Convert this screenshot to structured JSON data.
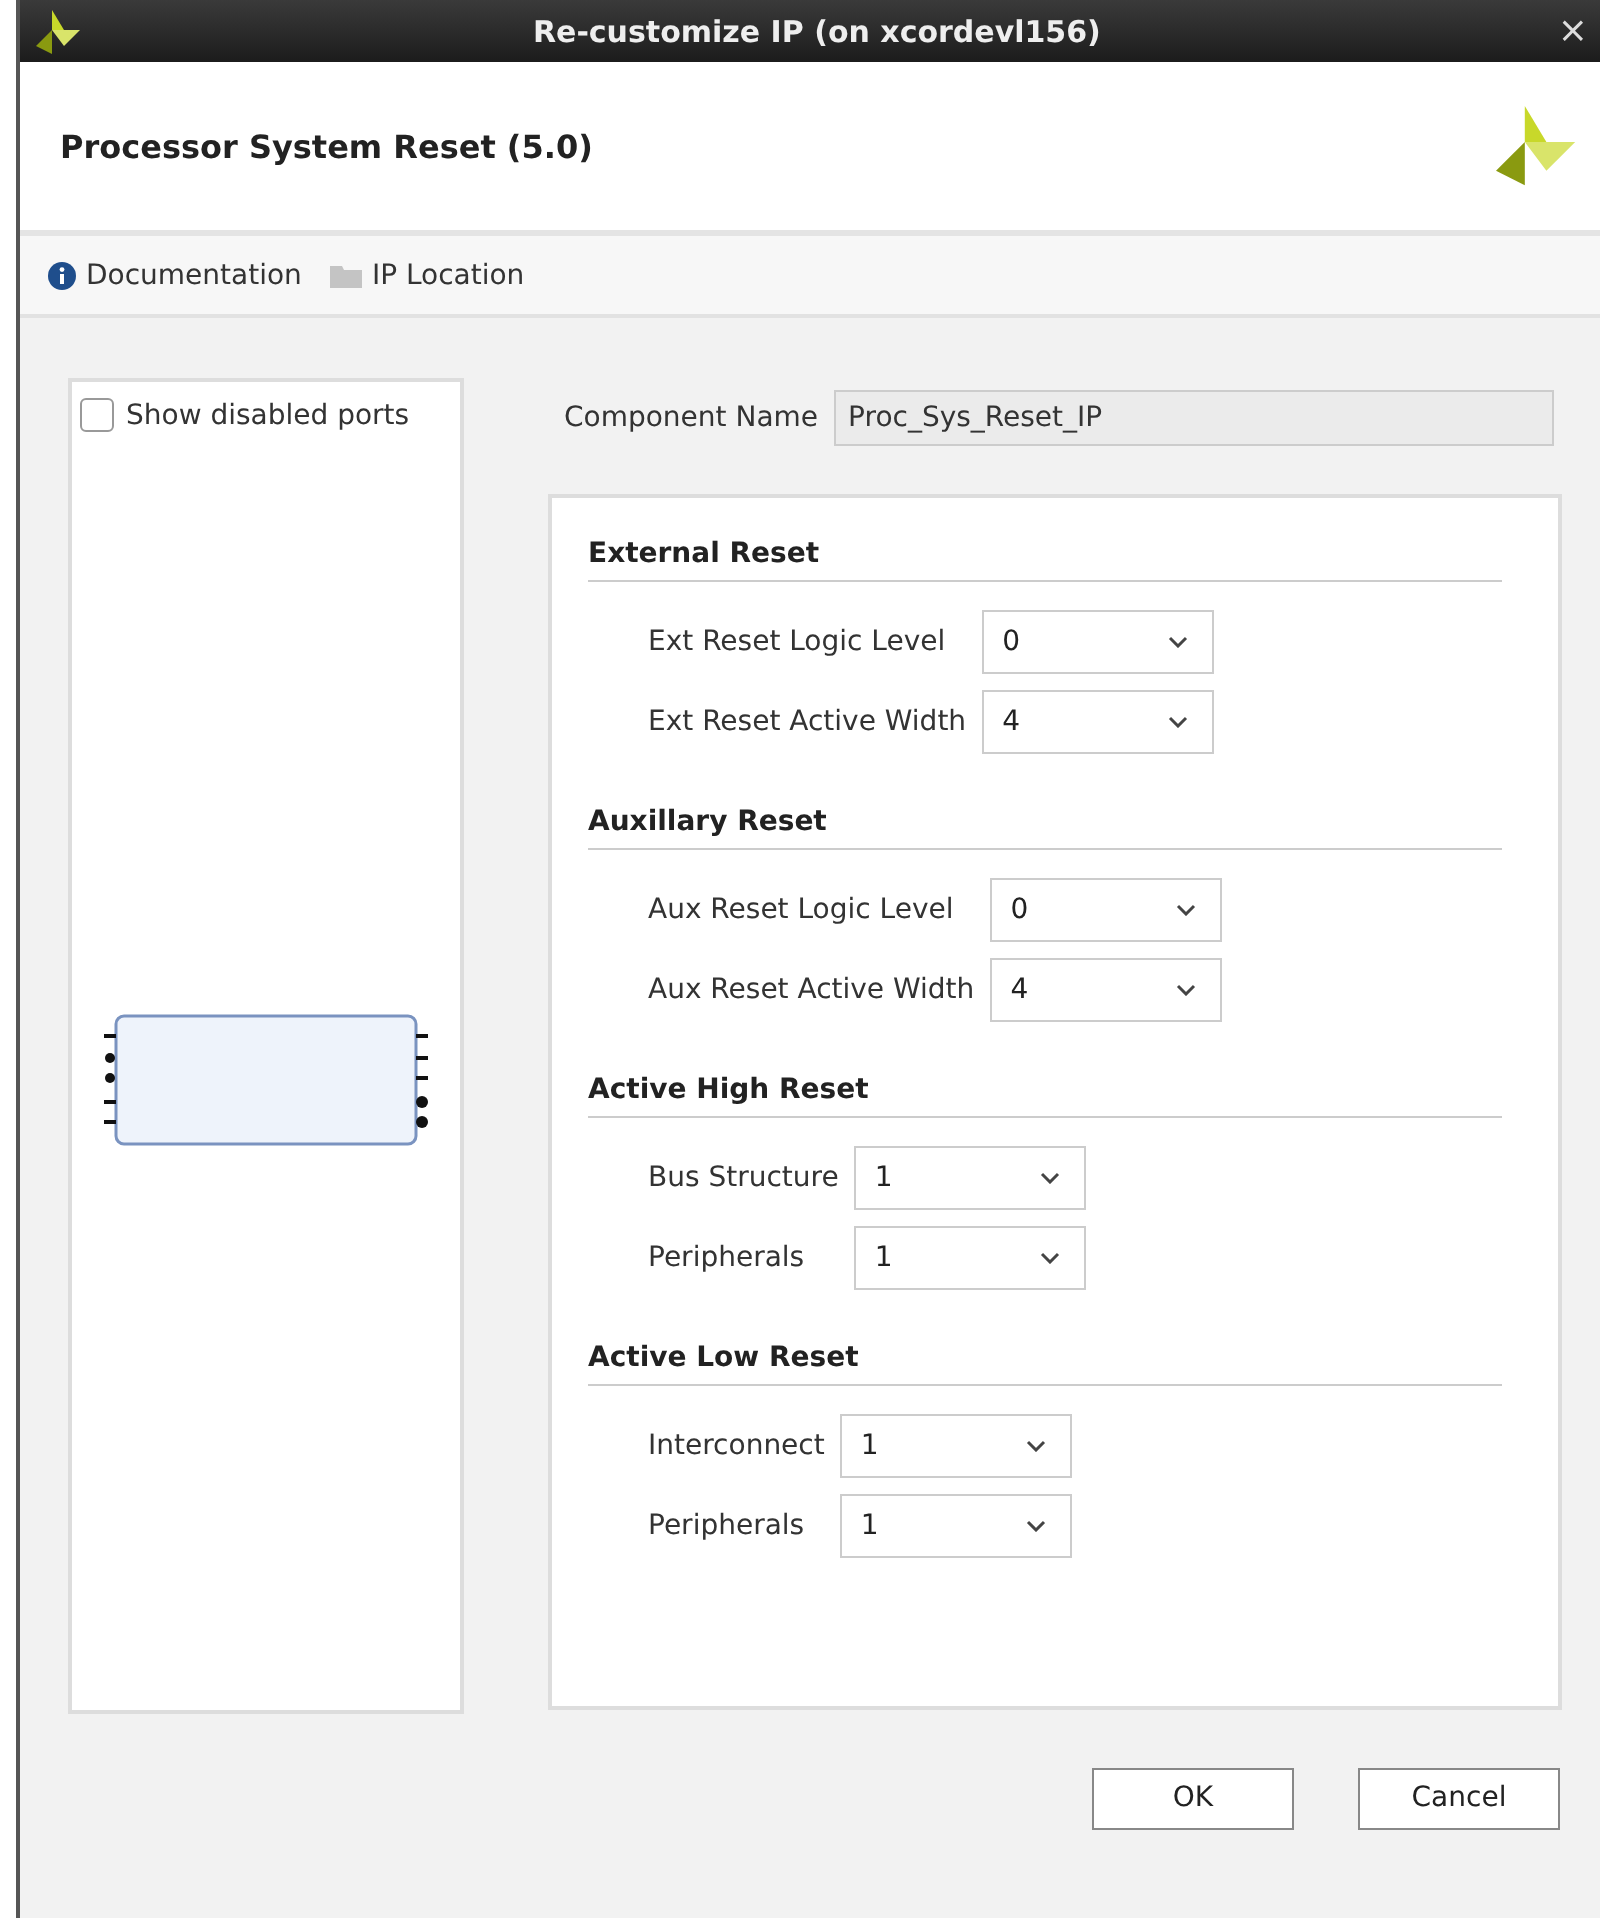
{
  "window": {
    "title": "Re-customize IP (on xcordevl156)",
    "close": "×"
  },
  "header": {
    "title": "Processor System Reset (5.0)"
  },
  "toolbar": [
    {
      "kind": "info",
      "label": "Documentation"
    },
    {
      "kind": "folder",
      "label": "IP Location"
    }
  ],
  "left_panel": {
    "checkbox": {
      "label": "Show disabled ports",
      "checked": false
    }
  },
  "component_name": {
    "label": "Component Name",
    "value": "Proc_Sys_Reset_IP"
  },
  "sections": [
    {
      "title": "External Reset",
      "rows": [
        {
          "label": "Ext Reset Logic Level",
          "value": "0"
        },
        {
          "label": "Ext Reset Active Width",
          "value": "4"
        }
      ]
    },
    {
      "title": "Auxillary Reset",
      "rows": [
        {
          "label": "Aux Reset Logic Level",
          "value": "0"
        },
        {
          "label": "Aux Reset Active Width",
          "value": "4"
        }
      ]
    },
    {
      "title": "Active High Reset",
      "rows": [
        {
          "label": "Bus Structure",
          "value": "1"
        },
        {
          "label": "Peripherals",
          "value": "1"
        }
      ]
    },
    {
      "title": "Active Low Reset",
      "rows": [
        {
          "label": "Interconnect",
          "value": "1"
        },
        {
          "label": "Peripherals",
          "value": "1"
        }
      ]
    }
  ],
  "buttons": [
    "OK",
    "Cancel"
  ]
}
